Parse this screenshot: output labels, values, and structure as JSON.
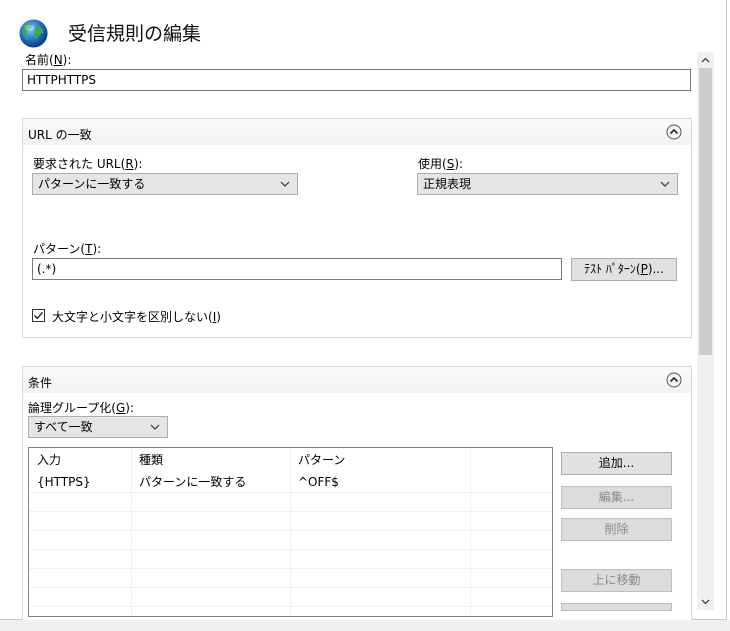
{
  "header": {
    "title": "受信規則の編集"
  },
  "name_field": {
    "label": "名前(N):",
    "value": "HTTPHTTPS"
  },
  "url_match": {
    "title": "URL の一致",
    "requested_url_label": "要求された URL(R):",
    "requested_url_value": "パターンに一致する",
    "using_label": "使用(S):",
    "using_value": "正規表現",
    "pattern_label": "パターン(T):",
    "pattern_value": "(.*)",
    "test_button": "ﾃｽﾄ ﾊﾟﾀｰﾝ(P)...",
    "ignore_case_label": "大文字と小文字を区別しない(I)",
    "ignore_case_checked": true
  },
  "conditions": {
    "title": "条件",
    "grouping_label": "論理グループ化(G):",
    "grouping_value": "すべて一致",
    "columns": [
      "入力",
      "種類",
      "パターン"
    ],
    "rows": [
      [
        "{HTTPS}",
        "パターンに一致する",
        "^OFF$"
      ]
    ],
    "buttons": {
      "add": "追加...",
      "edit": "編集...",
      "remove": "削除",
      "move_up": "上に移動"
    }
  }
}
